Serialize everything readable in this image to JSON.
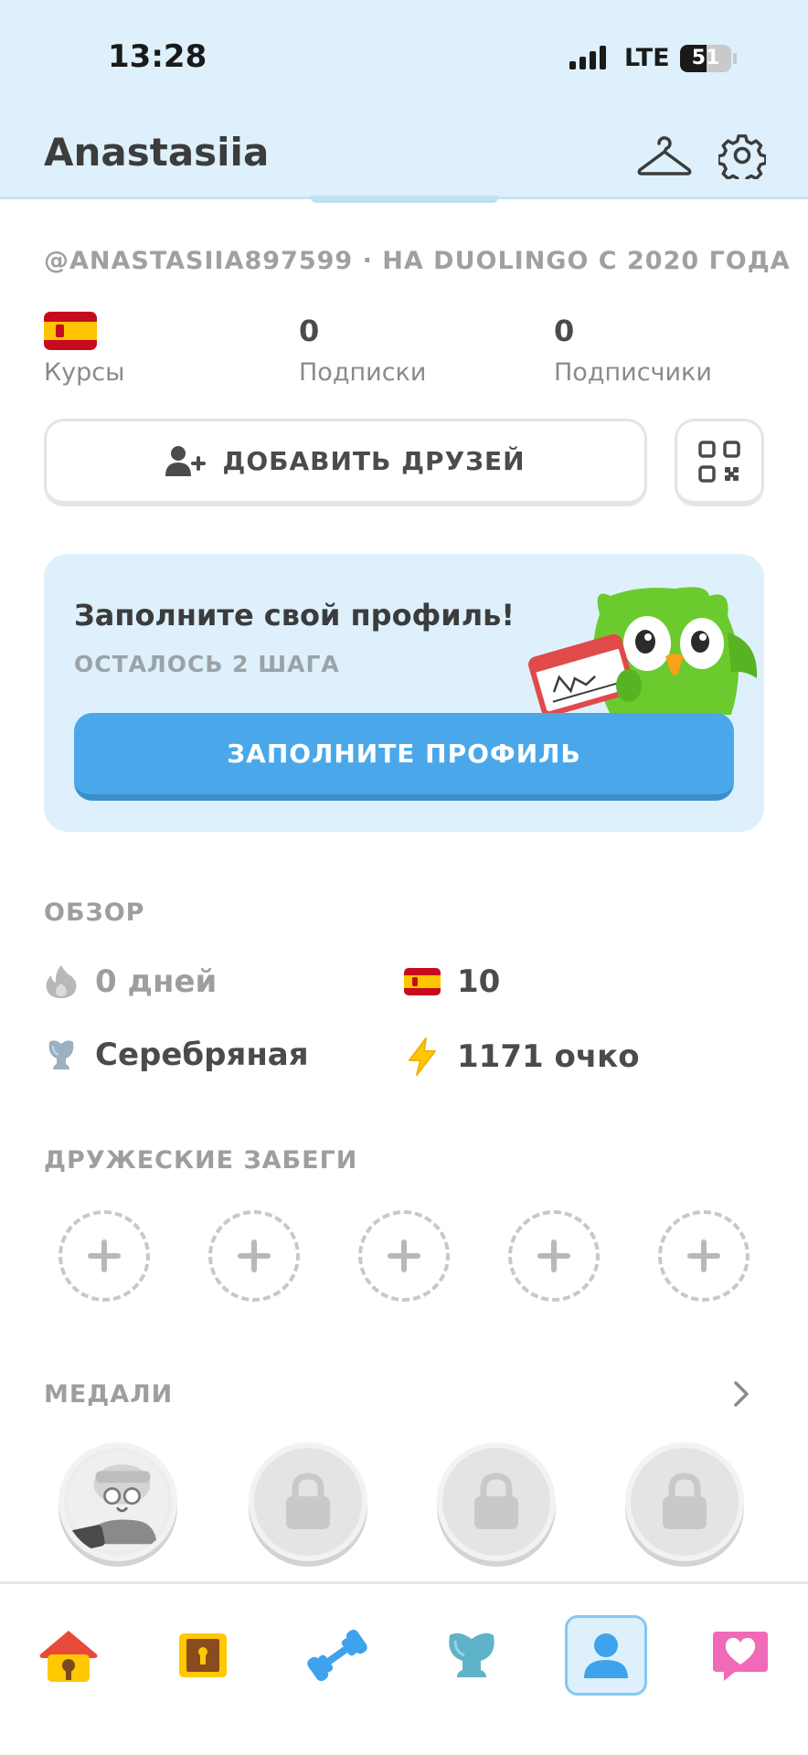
{
  "status_bar": {
    "time": "13:28",
    "network": "LTE",
    "battery": "51",
    "battery_level": 0.51
  },
  "header": {
    "name": "Anastasiia"
  },
  "profile": {
    "username_line": "@ANASTASIIA897599 · НА DUOLINGO С 2020 ГОДА",
    "courses_label": "Курсы",
    "following_value": "0",
    "following_label": "Подписки",
    "followers_value": "0",
    "followers_label": "Подписчики"
  },
  "add_friends": {
    "label": "ДОБАВИТЬ ДРУЗЕЙ"
  },
  "complete_profile": {
    "title": "Заполните свой профиль!",
    "subtitle": "ОСТАЛОСЬ 2 ШАГА",
    "button": "ЗАПОЛНИТЕ ПРОФИЛЬ"
  },
  "overview": {
    "title": "ОБЗОР",
    "streak": "0 дней",
    "course_xp": "10",
    "league": "Серебряная",
    "points": "1171 очко"
  },
  "friend_quests": {
    "title": "ДРУЖЕСКИЕ ЗАБЕГИ",
    "slots": 5
  },
  "medals": {
    "title": "МЕДАЛИ"
  },
  "colors": {
    "accent": "#4aa8ea",
    "header_bg": "#ddf0fb",
    "card_bg": "#ddf0fb",
    "text": "#4b4b4b",
    "muted": "#9e9e9e"
  },
  "tabs": [
    "home-icon",
    "chest-icon",
    "dumbbell-icon",
    "trophy-icon",
    "profile-icon",
    "heart-message-icon"
  ]
}
